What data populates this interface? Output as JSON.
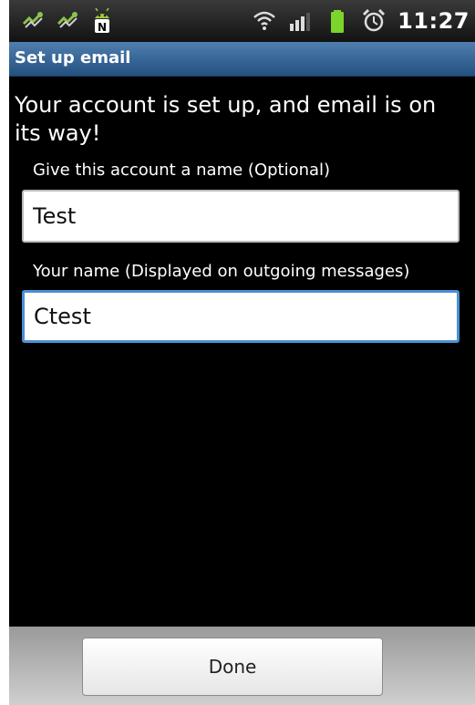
{
  "status_bar": {
    "time": "11:27",
    "left_icons": [
      "usb-debug-icon",
      "usb-connection-icon",
      "android-notification-icon"
    ],
    "right_icons": [
      "wifi-icon",
      "signal-icon",
      "battery-icon",
      "alarm-icon"
    ]
  },
  "title_bar": {
    "title": "Set up email"
  },
  "content": {
    "message": "Your account is set up, and email is on its way!",
    "account_name_label": "Give this account a name (Optional)",
    "account_name_value": "Test",
    "your_name_label": "Your name (Displayed on outgoing messages)",
    "your_name_value": "Ctest"
  },
  "footer": {
    "done_label": "Done"
  },
  "colors": {
    "title_bar": "#3c6a9a",
    "focus_border": "#4a90d6",
    "battery": "#7cd52a",
    "usb_icon": "#7cb342"
  }
}
